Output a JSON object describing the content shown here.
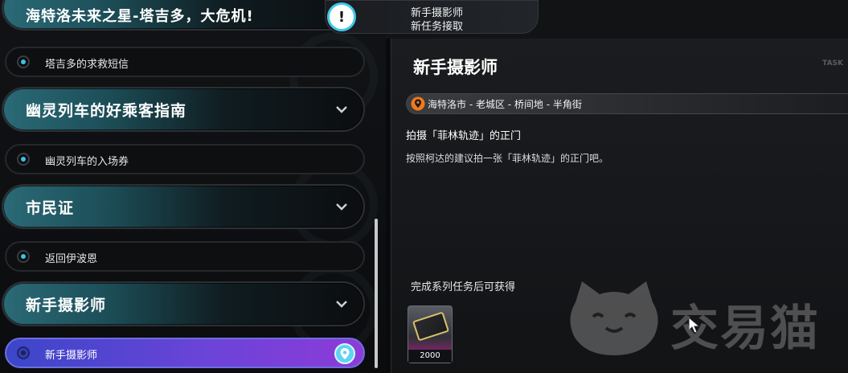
{
  "left_list": {
    "partial_header": {
      "title": "海特洛未来之星-塔吉多，大危机!"
    },
    "groups": [
      {
        "title": "幽灵列车的好乘客指南"
      },
      {
        "title": "市民证"
      },
      {
        "title": "新手摄影师"
      }
    ],
    "items": [
      {
        "label": "塔吉多的求救短信"
      },
      {
        "label": "幽灵列车的入场券"
      },
      {
        "label": "返回伊波恩"
      },
      {
        "label": "新手摄影师"
      }
    ]
  },
  "notification": {
    "line1": "新手摄影师",
    "line2": "新任务接取",
    "badge": "!"
  },
  "detail": {
    "title": "新手摄影师",
    "location": "海特洛市 - 老城区 - 桥间地 - 半角街",
    "objective": "拍摄「菲林轨迹」的正门",
    "description": "按照柯达的建议拍一张「菲林轨迹」的正门吧。",
    "reward_caption": "完成系列任务后可获得",
    "reward_amount": "2000",
    "corner_tag": "TASK"
  },
  "watermark": {
    "text": "交易猫"
  },
  "colors": {
    "accent_cyan": "#39c4e6",
    "active_purple": "#6a44d8",
    "location_orange": "#f07a1a"
  }
}
